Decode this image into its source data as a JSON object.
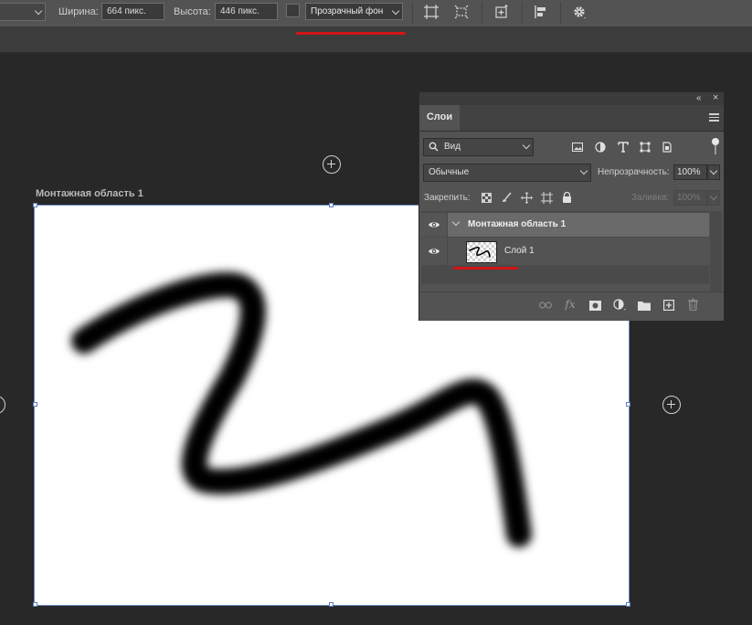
{
  "options_bar": {
    "width_label": "Ширина:",
    "width_value": "664 пикс.",
    "height_label": "Высота:",
    "height_value": "446 пикс.",
    "background_select": "Прозрачный фон",
    "icons": [
      "artboard-resize-icon",
      "crop-artboard-icon",
      "add-artboard-icon",
      "align-icon",
      "settings-gear-icon"
    ]
  },
  "artboard": {
    "title": "Монтажная область 1"
  },
  "layers_panel": {
    "tab": "Слои",
    "filter_select": "Вид",
    "blend_mode": "Обычные",
    "opacity_label": "Непрозрачность:",
    "opacity_value": "100%",
    "lock_label": "Закрепить:",
    "fill_label": "Заливка:",
    "fill_value": "100%",
    "group_name": "Монтажная область 1",
    "layer_name": "Слой 1"
  },
  "colors": {
    "highlight_underline": "#d21414",
    "artboard_outline": "#6d8cc4"
  }
}
